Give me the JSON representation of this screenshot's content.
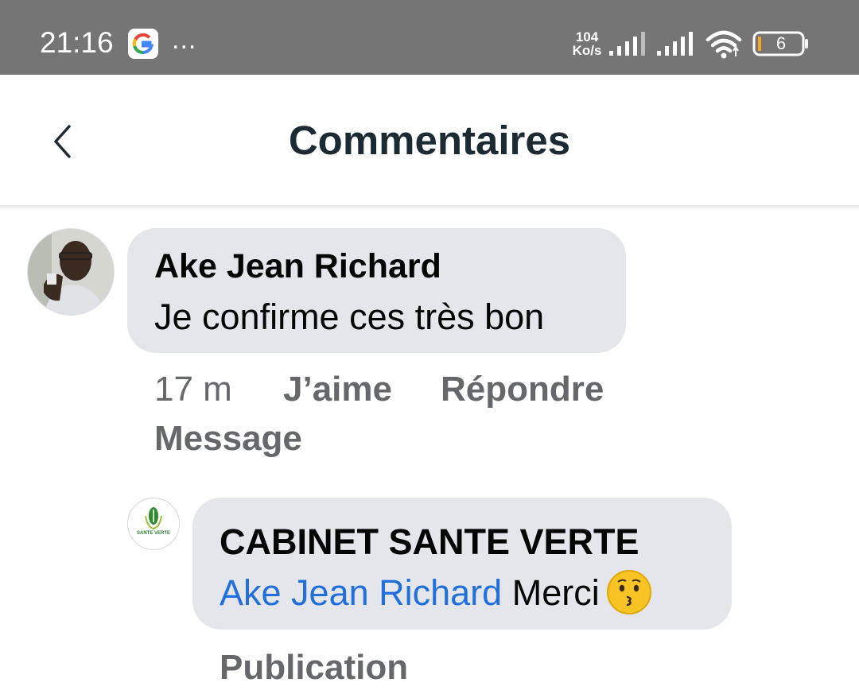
{
  "status_bar": {
    "time": "21:16",
    "more_icon": "...",
    "net_speed_value": "104",
    "net_speed_unit": "Ko/s",
    "battery_level": "6"
  },
  "header": {
    "title": "Commentaires"
  },
  "comments": [
    {
      "author": "Ake Jean Richard",
      "text": "Je confirme ces très bon",
      "time": "17 m",
      "like_label": "J’aime",
      "reply_label": "Répondre",
      "message_label": "Message",
      "replies": [
        {
          "author": "CABINET SANTE VERTE",
          "avatar_text": "SANTE VERTE",
          "mention": "Ake Jean Richard",
          "text": "Merci",
          "partial_action": "Publication"
        }
      ]
    }
  ],
  "colors": {
    "status_bar": "#757575",
    "bubble": "#e4e6eb",
    "mention": "#216fdb",
    "meta_text": "#65676b",
    "title": "#1c2b33"
  }
}
